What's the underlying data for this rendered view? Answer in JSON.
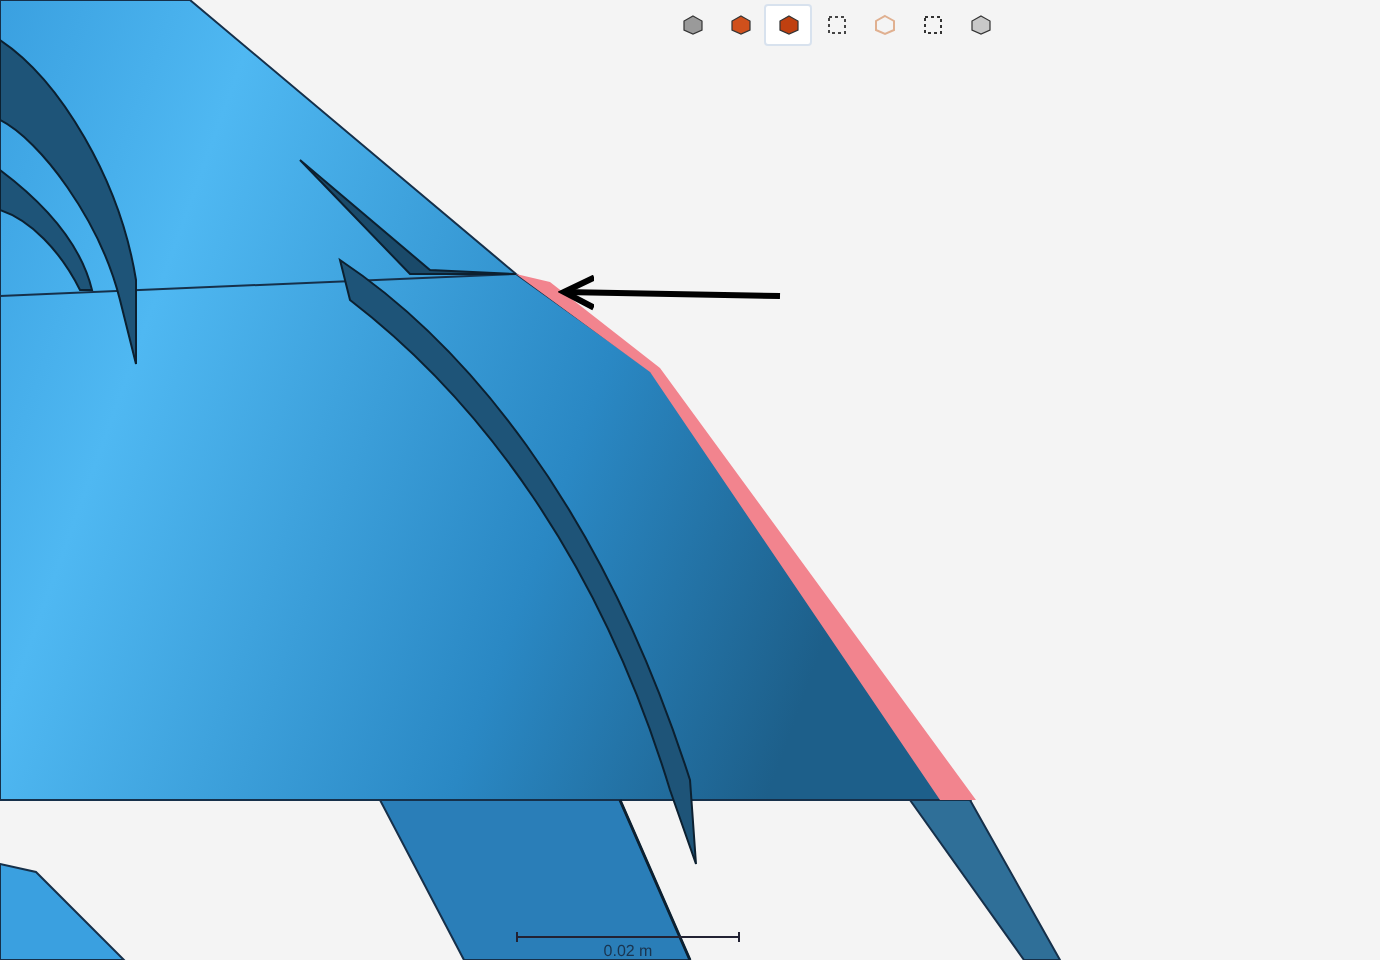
{
  "toolbar": [
    {
      "selected": false
    },
    {
      "selected": false
    },
    {
      "selected": true
    },
    {
      "selected": false
    },
    {
      "selected": false
    },
    {
      "selected": false
    },
    {
      "selected": false
    }
  ],
  "scale_bar": {
    "label": "0.02 m"
  }
}
